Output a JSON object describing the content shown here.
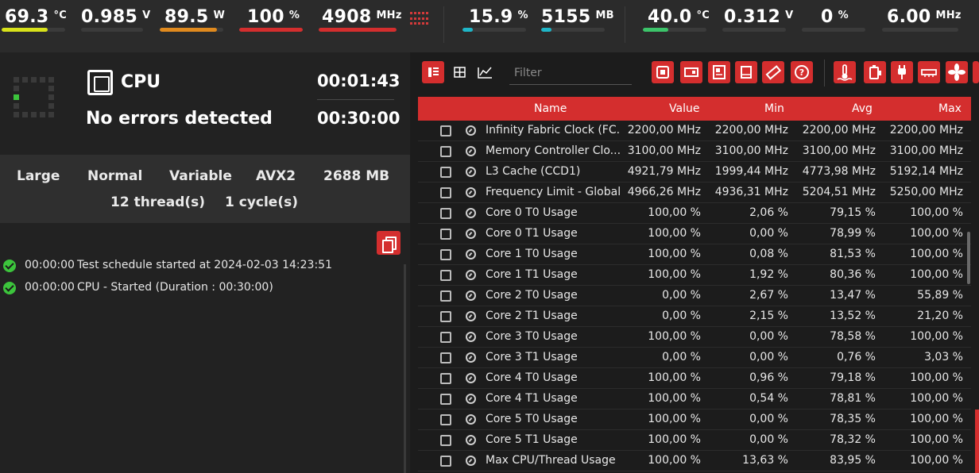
{
  "top_metrics": [
    {
      "value": "69.3",
      "unit": "°C",
      "color": "#d8e21a",
      "fill": 0.72
    },
    {
      "value": "0.985",
      "unit": "V",
      "color": "#3b3b3b",
      "fill": 0.0
    },
    {
      "value": "89.5",
      "unit": "W",
      "color": "#e08a1e",
      "fill": 0.9
    },
    {
      "value": "100",
      "unit": "%",
      "color": "#d42e2e",
      "fill": 1.0
    },
    {
      "value": "4908",
      "unit": "MHz",
      "color": "#d42e2e",
      "fill": 1.0
    },
    {
      "value": "15.9",
      "unit": "%",
      "color": "#1fb6c8",
      "fill": 0.16
    },
    {
      "value": "5155",
      "unit": "MB",
      "color": "#1fb6c8",
      "fill": 0.16
    },
    {
      "value": "40.0",
      "unit": "°C",
      "color": "#3cc46a",
      "fill": 0.4
    },
    {
      "value": "0.312",
      "unit": "V",
      "color": "#3b3b3b",
      "fill": 0.0
    },
    {
      "value": "0",
      "unit": "%",
      "color": "#3b3b3b",
      "fill": 0.0
    },
    {
      "value": "6.00",
      "unit": "MHz",
      "color": "#3b3b3b",
      "fill": 0.0
    }
  ],
  "test": {
    "title": "CPU",
    "elapsed": "00:01:43",
    "status": "No errors detected",
    "duration": "00:30:00"
  },
  "settings": {
    "size": "Large",
    "mode": "Normal",
    "variant": "Variable",
    "instruction": "AVX2",
    "memory": "2688 MB",
    "threads": "12 thread(s)",
    "cycles": "1 cycle(s)"
  },
  "log": [
    {
      "time": "00:00:00",
      "message": "Test schedule started at 2024-02-03 14:23:51"
    },
    {
      "time": "00:00:00",
      "message": "CPU - Started (Duration : 00:30:00)"
    }
  ],
  "filter": {
    "placeholder": "Filter",
    "value": ""
  },
  "toolbar": {
    "view_icons": [
      "sidebar-view-icon",
      "grid-view-icon",
      "chart-view-icon"
    ],
    "category_icons": [
      "cpu-icon",
      "gpu-icon",
      "motherboard-icon",
      "drive-icon",
      "memory-icon",
      "help-icon",
      "temperature-icon",
      "battery-icon",
      "power-icon",
      "ram-stick-icon",
      "fan-icon"
    ]
  },
  "table": {
    "headers": {
      "name": "Name",
      "value": "Value",
      "min": "Min",
      "avg": "Avg",
      "max": "Max"
    },
    "rows": [
      {
        "name": "Infinity Fabric Clock (FC...",
        "value": "2200,00 MHz",
        "min": "2200,00 MHz",
        "avg": "2200,00 MHz",
        "max": "2200,00 MHz"
      },
      {
        "name": "Memory Controller Clo...",
        "value": "3100,00 MHz",
        "min": "3100,00 MHz",
        "avg": "3100,00 MHz",
        "max": "3100,00 MHz"
      },
      {
        "name": "L3 Cache (CCD1)",
        "value": "4921,79 MHz",
        "min": "1999,44 MHz",
        "avg": "4773,98 MHz",
        "max": "5192,14 MHz"
      },
      {
        "name": "Frequency Limit - Global",
        "value": "4966,26 MHz",
        "min": "4936,31 MHz",
        "avg": "5204,51 MHz",
        "max": "5250,00 MHz"
      },
      {
        "name": "Core 0 T0 Usage",
        "value": "100,00 %",
        "min": "2,06 %",
        "avg": "79,15 %",
        "max": "100,00 %"
      },
      {
        "name": "Core 0 T1 Usage",
        "value": "100,00 %",
        "min": "0,00 %",
        "avg": "78,99 %",
        "max": "100,00 %"
      },
      {
        "name": "Core 1 T0 Usage",
        "value": "100,00 %",
        "min": "0,08 %",
        "avg": "81,53 %",
        "max": "100,00 %"
      },
      {
        "name": "Core 1 T1 Usage",
        "value": "100,00 %",
        "min": "1,92 %",
        "avg": "80,36 %",
        "max": "100,00 %"
      },
      {
        "name": "Core 2 T0 Usage",
        "value": "0,00 %",
        "min": "2,67 %",
        "avg": "13,47 %",
        "max": "55,89 %"
      },
      {
        "name": "Core 2 T1 Usage",
        "value": "0,00 %",
        "min": "2,15 %",
        "avg": "13,52 %",
        "max": "21,20 %"
      },
      {
        "name": "Core 3 T0 Usage",
        "value": "100,00 %",
        "min": "0,00 %",
        "avg": "78,58 %",
        "max": "100,00 %"
      },
      {
        "name": "Core 3 T1 Usage",
        "value": "0,00 %",
        "min": "0,00 %",
        "avg": "0,76 %",
        "max": "3,03 %"
      },
      {
        "name": "Core 4 T0 Usage",
        "value": "100,00 %",
        "min": "0,96 %",
        "avg": "79,18 %",
        "max": "100,00 %"
      },
      {
        "name": "Core 4 T1 Usage",
        "value": "100,00 %",
        "min": "0,54 %",
        "avg": "78,81 %",
        "max": "100,00 %"
      },
      {
        "name": "Core 5 T0 Usage",
        "value": "100,00 %",
        "min": "0,00 %",
        "avg": "78,35 %",
        "max": "100,00 %"
      },
      {
        "name": "Core 5 T1 Usage",
        "value": "100,00 %",
        "min": "0,00 %",
        "avg": "78,32 %",
        "max": "100,00 %"
      },
      {
        "name": "Max CPU/Thread Usage",
        "value": "100,00 %",
        "min": "13,63 %",
        "avg": "83,95 %",
        "max": "100,00 %"
      }
    ]
  }
}
